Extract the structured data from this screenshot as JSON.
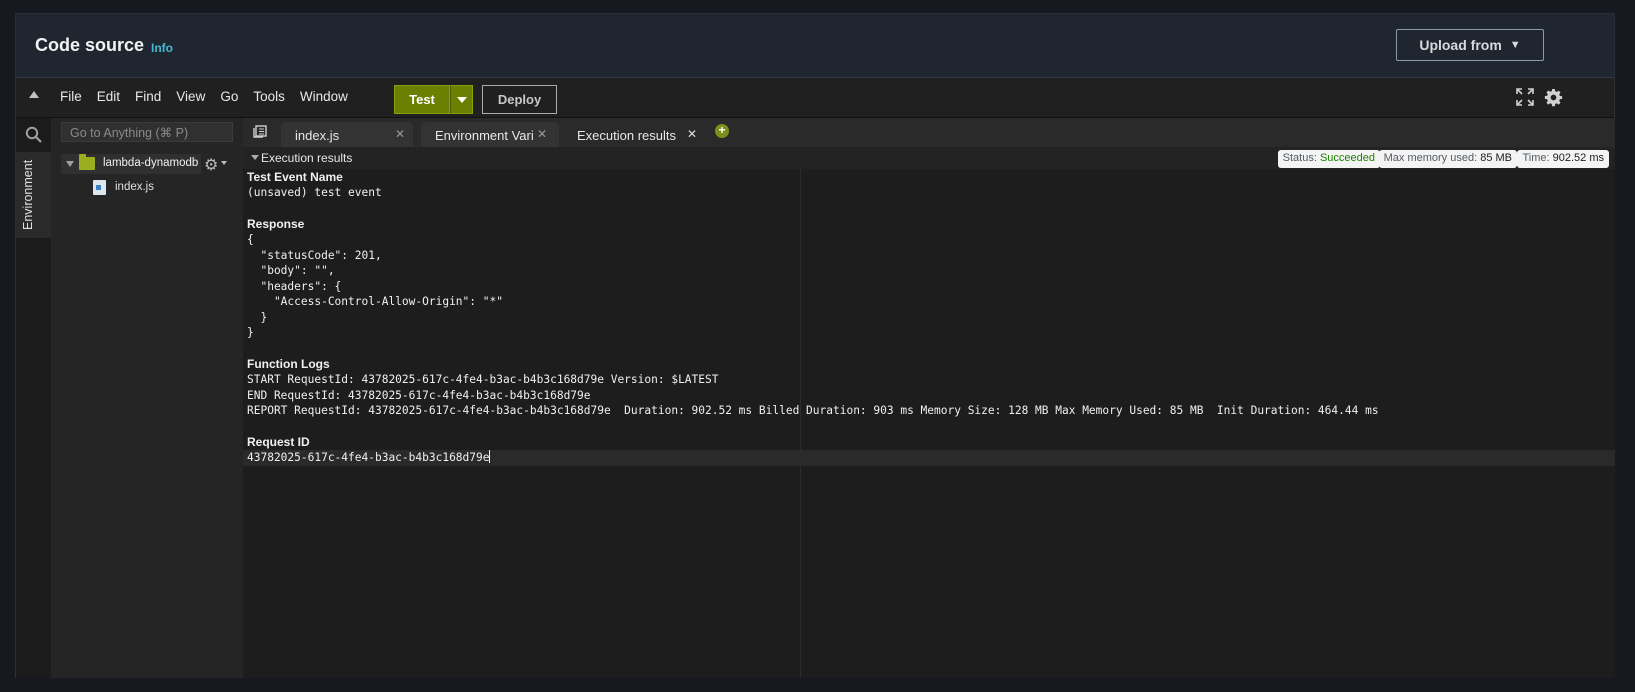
{
  "header": {
    "title": "Code source",
    "info_link": "Info",
    "upload_button": "Upload from"
  },
  "menubar": {
    "items": [
      "File",
      "Edit",
      "Find",
      "View",
      "Go",
      "Tools",
      "Window"
    ],
    "test_button": "Test",
    "deploy_button": "Deploy"
  },
  "sidebar": {
    "goto_placeholder": "Go to Anything (⌘ P)",
    "environment_tab": "Environment",
    "folder_name": "lambda-dynamodb",
    "file_name": "index.js"
  },
  "tabs": [
    {
      "label": "index.js",
      "active": false
    },
    {
      "label": "Environment Vari",
      "active": false
    },
    {
      "label": "Execution results",
      "active": true
    }
  ],
  "results": {
    "panel_title": "Execution results",
    "status_label": "Status:",
    "status_value": "Succeeded",
    "memory_label": "Max memory used:",
    "memory_value": "85 MB",
    "time_label": "Time:",
    "time_value": "902.52 ms",
    "test_event_heading": "Test Event Name",
    "test_event_value": "(unsaved) test event",
    "response_heading": "Response",
    "response_lines": [
      "{",
      "  \"statusCode\": 201,",
      "  \"body\": \"\",",
      "  \"headers\": {",
      "    \"Access-Control-Allow-Origin\": \"*\"",
      "  }",
      "}"
    ],
    "logs_heading": "Function Logs",
    "log_lines": [
      "START RequestId: 43782025-617c-4fe4-b3ac-b4b3c168d79e Version: $LATEST",
      "END RequestId: 43782025-617c-4fe4-b3ac-b4b3c168d79e",
      "REPORT RequestId: 43782025-617c-4fe4-b3ac-b4b3c168d79e  Duration: 902.52 ms Billed Duration: 903 ms Memory Size: 128 MB Max Memory Used: 85 MB  Init Duration: 464.44 ms"
    ],
    "request_id_heading": "Request ID",
    "request_id_value": "43782025-617c-4fe4-b3ac-b4b3c168d79e"
  },
  "colors": {
    "accent_green": "#6b7f00",
    "status_success": "#1d8102",
    "info_link": "#44b9d6"
  }
}
